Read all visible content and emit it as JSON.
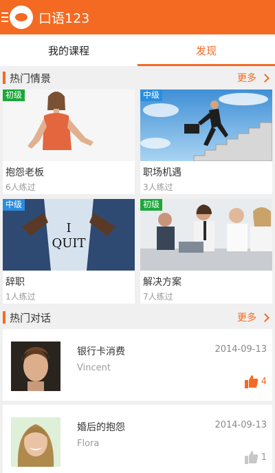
{
  "app": {
    "title": "口语123",
    "accent": "#f46a22"
  },
  "tabs": [
    {
      "label": "我的课程"
    },
    {
      "label": "发现"
    }
  ],
  "hot_scenes": {
    "title": "热门情景",
    "more": "更多",
    "items": [
      {
        "title": "抱怨老板",
        "count": "6人练过",
        "level": "初级"
      },
      {
        "title": "职场机遇",
        "count": "3人练过",
        "level": "中级"
      },
      {
        "title": "辞职",
        "count": "1人练过",
        "level": "中级"
      },
      {
        "title": "解决方案",
        "count": "7人练过",
        "level": "初级"
      }
    ]
  },
  "quit_sign": {
    "line1": "I",
    "line2": "QUIT"
  },
  "hot_dialogs": {
    "title": "热门对话",
    "more": "更多",
    "items": [
      {
        "title": "银行卡消费",
        "name": "Vincent",
        "date": "2014-09-13",
        "likes": "4",
        "liked": true
      },
      {
        "title": "婚后的抱怨",
        "name": "Flora",
        "date": "2014-09-13",
        "likes": "1",
        "liked": false
      }
    ]
  }
}
